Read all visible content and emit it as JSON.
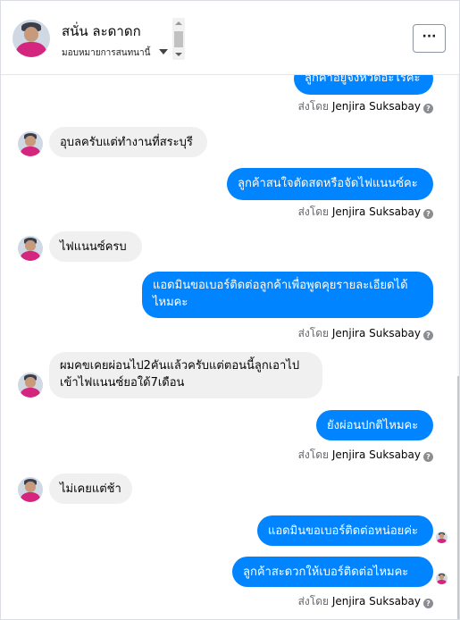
{
  "header": {
    "contact_name": "สนั่น ละดาดก",
    "assign_label": "มอบหมายการสนทนานี้",
    "more_label": "···"
  },
  "messages": [
    {
      "dir": "out",
      "text": "ลูกค้าอยู่จังหวัดอะไรคะ",
      "sent_by": "ส่งโดย",
      "agent": "Jenjira Suksabay"
    },
    {
      "dir": "in",
      "text": "อุบลครับแต่ทำงานที่สระบุรี"
    },
    {
      "dir": "out",
      "text": "ลูกค้าสนใจตัดสดหรือจัดไฟแนนซ์คะ",
      "sent_by": "ส่งโดย",
      "agent": "Jenjira Suksabay"
    },
    {
      "dir": "in",
      "text": "ไฟแนนซ์ครบ"
    },
    {
      "dir": "out",
      "text": "แอดมินขอเบอร์ติดต่อลูกค้าเพื่อพูดคุยรายละเอียดได้ไหมคะ",
      "sent_by": "ส่งโดย",
      "agent": "Jenjira Suksabay"
    },
    {
      "dir": "in",
      "text": "ผมคขเคยผ่อนไป2คันแล้วครับแต่ตอนนี้ลูกเอาไปเข้าไฟแนนซ์ยอใด้7เดือน"
    },
    {
      "dir": "out",
      "text": "ยังผ่อนปกติไหมคะ",
      "sent_by": "ส่งโดย",
      "agent": "Jenjira Suksabay"
    },
    {
      "dir": "in",
      "text": "ไม่เคยแต่ช้า"
    },
    {
      "dir": "out",
      "text": "แอดมินขอเบอร์ติดต่อหน่อยค่ะ"
    },
    {
      "dir": "out",
      "text": "ลูกค้าสะดวกให้เบอร์ติดต่อไหมคะ",
      "sent_by": "ส่งโดย",
      "agent": "Jenjira Suksabay"
    }
  ],
  "colors": {
    "outgoing": "#0084ff",
    "incoming": "#f0f0f0",
    "accent_shirt": "#d4257f"
  },
  "icons": {
    "more": "ellipsis-icon",
    "info": "question-circle-icon",
    "dropdown": "caret-down-icon"
  }
}
